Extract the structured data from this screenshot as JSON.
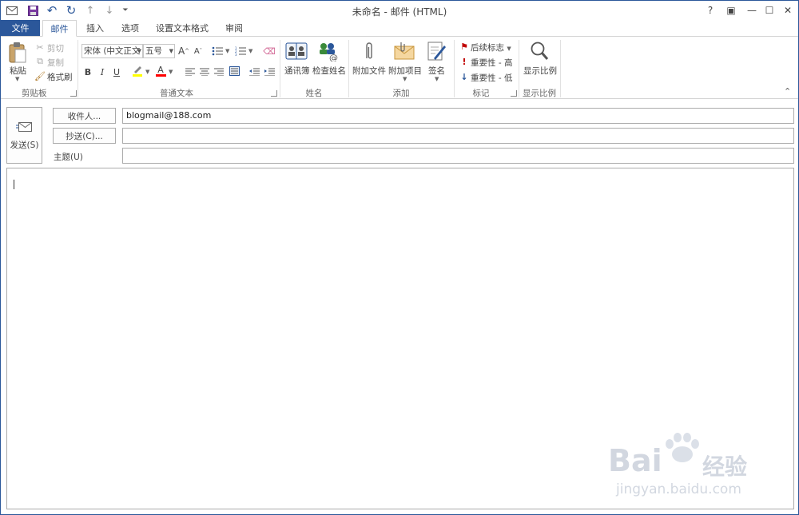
{
  "window": {
    "title": "未命名 - 邮件 (HTML)",
    "buttons": {
      "help": "?",
      "restore_ribbon": "▣",
      "minimize": "—",
      "maximize": "☐",
      "close": "✕"
    }
  },
  "tabs": [
    {
      "label": "文件"
    },
    {
      "label": "邮件"
    },
    {
      "label": "插入"
    },
    {
      "label": "选项"
    },
    {
      "label": "设置文本格式"
    },
    {
      "label": "审阅"
    }
  ],
  "ribbon": {
    "clipboard": {
      "paste": "粘贴",
      "cut": "剪切",
      "copy": "复制",
      "format_painter": "格式刷",
      "group_label": "剪贴板"
    },
    "basic_text": {
      "font": "宋体 (中文正文",
      "size": "五号",
      "bold": "B",
      "italic": "I",
      "underline": "U",
      "grow": "A",
      "shrink": "A",
      "font_color": "A",
      "group_label": "普通文本"
    },
    "names": {
      "address_book": "通讯簿",
      "check_names": "检查姓名",
      "group_label": "姓名"
    },
    "include": {
      "attach_file": "附加文件",
      "attach_item": "附加项目",
      "signature": "签名",
      "group_label": "添加"
    },
    "tags": {
      "follow_up": "后续标志",
      "high_importance": "重要性 - 高",
      "low_importance": "重要性 - 低",
      "group_label": "标记"
    },
    "zoom": {
      "zoom": "显示比例",
      "group_label": "显示比例"
    }
  },
  "form": {
    "send": "发送(S)",
    "to_button": "收件人...",
    "cc_button": "抄送(C)...",
    "subject_label": "主题(U)",
    "to_value": "blogmail@188.com",
    "cc_value": "",
    "subject_value": ""
  },
  "watermark": {
    "brand": "Bai",
    "brand_tail": "经验",
    "url": "jingyan.baidu.com"
  },
  "colors": {
    "accent": "#2b579a",
    "highlight": "#ffff00",
    "font_color": "#ff0000",
    "high_importance": "#c00000",
    "low_importance": "#2b579a"
  }
}
